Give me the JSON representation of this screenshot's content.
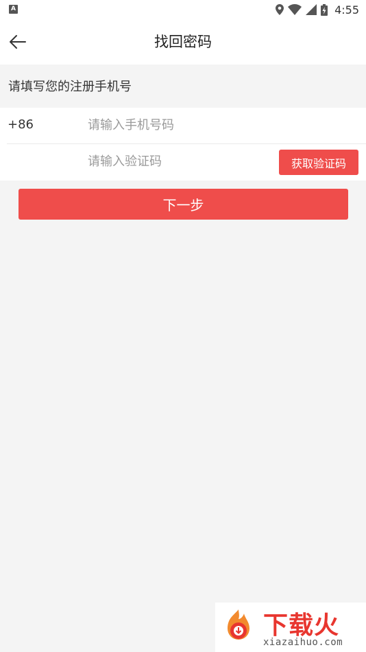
{
  "status_bar": {
    "time": "4:55",
    "icons": [
      "notification-a-icon",
      "location-icon",
      "wifi-icon",
      "signal-icon",
      "battery-icon"
    ]
  },
  "header": {
    "title": "找回密码",
    "back_icon": "arrow-left-icon"
  },
  "form": {
    "hint": "请填写您的注册手机号",
    "country_code": "+86",
    "phone_placeholder": "请输入手机号码",
    "code_placeholder": "请输入验证码",
    "get_code_label": "获取验证码"
  },
  "actions": {
    "next_label": "下一步"
  },
  "watermark": {
    "brand": "下载火",
    "url": "xiazaihuo.com"
  },
  "colors": {
    "accent": "#ef4d4b",
    "background": "#f4f4f4"
  }
}
